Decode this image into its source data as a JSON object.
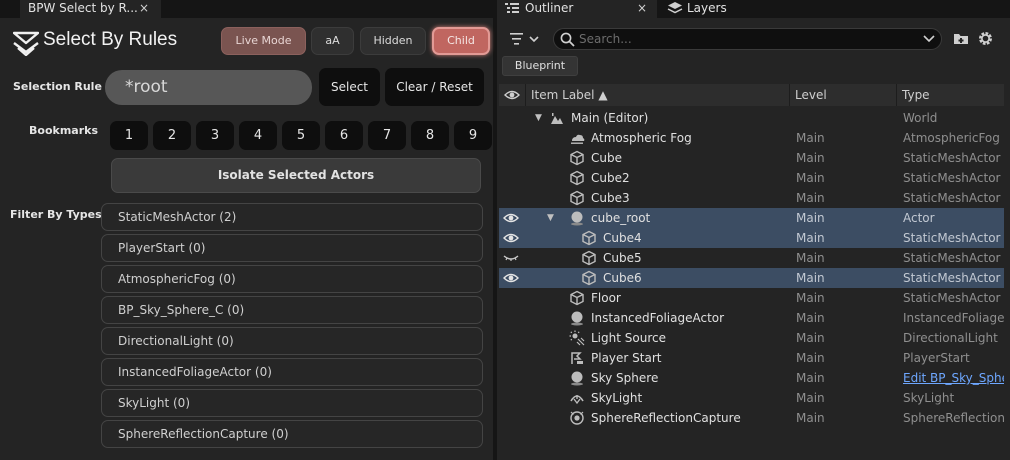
{
  "left_panel": {
    "tab_title": "BPW Select by R...",
    "tab_close": "×",
    "app_title": "Select By Rules",
    "modes": {
      "live": "Live Mode",
      "case": "aA",
      "hidden": "Hidden",
      "child": "Child"
    },
    "selection_rule_label": "Selection Rule",
    "selection_rule_value": "*root",
    "select_button": "Select",
    "clear_button": "Clear / Reset",
    "bookmarks_label": "Bookmarks",
    "bookmarks": [
      "1",
      "2",
      "3",
      "4",
      "5",
      "6",
      "7",
      "8",
      "9"
    ],
    "isolate_button": "Isolate Selected Actors",
    "filter_label": "Filter By Types",
    "type_filters": [
      "StaticMeshActor  (2)",
      "PlayerStart  (0)",
      "AtmosphericFog  (0)",
      "BP_Sky_Sphere_C  (0)",
      "DirectionalLight  (0)",
      "InstancedFoliageActor  (0)",
      "SkyLight  (0)",
      "SphereReflectionCapture  (0)"
    ]
  },
  "right_panel": {
    "tabs": {
      "outliner": "Outliner",
      "outliner_close": "×",
      "layers": "Layers"
    },
    "search_placeholder": "Search...",
    "filter_chip": "Blueprint",
    "columns": {
      "label": "Item Label ▲",
      "level": "Level",
      "type": "Type"
    },
    "rows": [
      {
        "name": "Main (Editor)",
        "level": "",
        "type": "World"
      },
      {
        "name": "Atmospheric Fog",
        "level": "Main",
        "type": "AtmosphericFog"
      },
      {
        "name": "Cube",
        "level": "Main",
        "type": "StaticMeshActor"
      },
      {
        "name": "Cube2",
        "level": "Main",
        "type": "StaticMeshActor"
      },
      {
        "name": "Cube3",
        "level": "Main",
        "type": "StaticMeshActor"
      },
      {
        "name": "cube_root",
        "level": "Main",
        "type": "Actor"
      },
      {
        "name": "Cube4",
        "level": "Main",
        "type": "StaticMeshActor"
      },
      {
        "name": "Cube5",
        "level": "Main",
        "type": "StaticMeshActor"
      },
      {
        "name": "Cube6",
        "level": "Main",
        "type": "StaticMeshActor"
      },
      {
        "name": "Floor",
        "level": "Main",
        "type": "StaticMeshActor"
      },
      {
        "name": "InstancedFoliageActor",
        "level": "Main",
        "type": "InstancedFoliageActor"
      },
      {
        "name": "Light Source",
        "level": "Main",
        "type": "DirectionalLight"
      },
      {
        "name": "Player Start",
        "level": "Main",
        "type": "PlayerStart"
      },
      {
        "name": "Sky Sphere",
        "level": "Main",
        "type": "Edit BP_Sky_Sphere"
      },
      {
        "name": "SkyLight",
        "level": "Main",
        "type": "SkyLight"
      },
      {
        "name": "SphereReflectionCapture",
        "level": "Main",
        "type": "SphereReflectionCapture"
      }
    ]
  }
}
